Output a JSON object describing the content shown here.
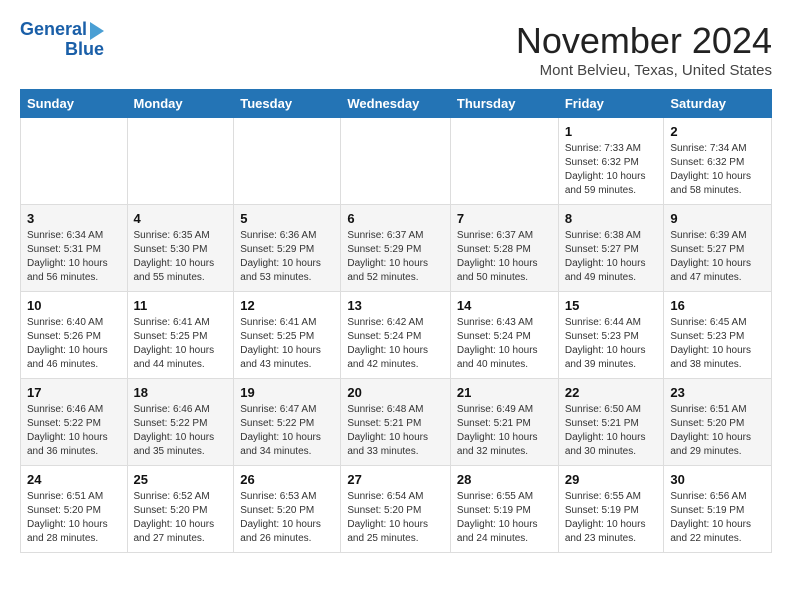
{
  "logo": {
    "line1": "General",
    "line2": "Blue"
  },
  "title": "November 2024",
  "subtitle": "Mont Belvieu, Texas, United States",
  "weekdays": [
    "Sunday",
    "Monday",
    "Tuesday",
    "Wednesday",
    "Thursday",
    "Friday",
    "Saturday"
  ],
  "weeks": [
    [
      {
        "day": "",
        "detail": ""
      },
      {
        "day": "",
        "detail": ""
      },
      {
        "day": "",
        "detail": ""
      },
      {
        "day": "",
        "detail": ""
      },
      {
        "day": "",
        "detail": ""
      },
      {
        "day": "1",
        "detail": "Sunrise: 7:33 AM\nSunset: 6:32 PM\nDaylight: 10 hours\nand 59 minutes."
      },
      {
        "day": "2",
        "detail": "Sunrise: 7:34 AM\nSunset: 6:32 PM\nDaylight: 10 hours\nand 58 minutes."
      }
    ],
    [
      {
        "day": "3",
        "detail": "Sunrise: 6:34 AM\nSunset: 5:31 PM\nDaylight: 10 hours\nand 56 minutes."
      },
      {
        "day": "4",
        "detail": "Sunrise: 6:35 AM\nSunset: 5:30 PM\nDaylight: 10 hours\nand 55 minutes."
      },
      {
        "day": "5",
        "detail": "Sunrise: 6:36 AM\nSunset: 5:29 PM\nDaylight: 10 hours\nand 53 minutes."
      },
      {
        "day": "6",
        "detail": "Sunrise: 6:37 AM\nSunset: 5:29 PM\nDaylight: 10 hours\nand 52 minutes."
      },
      {
        "day": "7",
        "detail": "Sunrise: 6:37 AM\nSunset: 5:28 PM\nDaylight: 10 hours\nand 50 minutes."
      },
      {
        "day": "8",
        "detail": "Sunrise: 6:38 AM\nSunset: 5:27 PM\nDaylight: 10 hours\nand 49 minutes."
      },
      {
        "day": "9",
        "detail": "Sunrise: 6:39 AM\nSunset: 5:27 PM\nDaylight: 10 hours\nand 47 minutes."
      }
    ],
    [
      {
        "day": "10",
        "detail": "Sunrise: 6:40 AM\nSunset: 5:26 PM\nDaylight: 10 hours\nand 46 minutes."
      },
      {
        "day": "11",
        "detail": "Sunrise: 6:41 AM\nSunset: 5:25 PM\nDaylight: 10 hours\nand 44 minutes."
      },
      {
        "day": "12",
        "detail": "Sunrise: 6:41 AM\nSunset: 5:25 PM\nDaylight: 10 hours\nand 43 minutes."
      },
      {
        "day": "13",
        "detail": "Sunrise: 6:42 AM\nSunset: 5:24 PM\nDaylight: 10 hours\nand 42 minutes."
      },
      {
        "day": "14",
        "detail": "Sunrise: 6:43 AM\nSunset: 5:24 PM\nDaylight: 10 hours\nand 40 minutes."
      },
      {
        "day": "15",
        "detail": "Sunrise: 6:44 AM\nSunset: 5:23 PM\nDaylight: 10 hours\nand 39 minutes."
      },
      {
        "day": "16",
        "detail": "Sunrise: 6:45 AM\nSunset: 5:23 PM\nDaylight: 10 hours\nand 38 minutes."
      }
    ],
    [
      {
        "day": "17",
        "detail": "Sunrise: 6:46 AM\nSunset: 5:22 PM\nDaylight: 10 hours\nand 36 minutes."
      },
      {
        "day": "18",
        "detail": "Sunrise: 6:46 AM\nSunset: 5:22 PM\nDaylight: 10 hours\nand 35 minutes."
      },
      {
        "day": "19",
        "detail": "Sunrise: 6:47 AM\nSunset: 5:22 PM\nDaylight: 10 hours\nand 34 minutes."
      },
      {
        "day": "20",
        "detail": "Sunrise: 6:48 AM\nSunset: 5:21 PM\nDaylight: 10 hours\nand 33 minutes."
      },
      {
        "day": "21",
        "detail": "Sunrise: 6:49 AM\nSunset: 5:21 PM\nDaylight: 10 hours\nand 32 minutes."
      },
      {
        "day": "22",
        "detail": "Sunrise: 6:50 AM\nSunset: 5:21 PM\nDaylight: 10 hours\nand 30 minutes."
      },
      {
        "day": "23",
        "detail": "Sunrise: 6:51 AM\nSunset: 5:20 PM\nDaylight: 10 hours\nand 29 minutes."
      }
    ],
    [
      {
        "day": "24",
        "detail": "Sunrise: 6:51 AM\nSunset: 5:20 PM\nDaylight: 10 hours\nand 28 minutes."
      },
      {
        "day": "25",
        "detail": "Sunrise: 6:52 AM\nSunset: 5:20 PM\nDaylight: 10 hours\nand 27 minutes."
      },
      {
        "day": "26",
        "detail": "Sunrise: 6:53 AM\nSunset: 5:20 PM\nDaylight: 10 hours\nand 26 minutes."
      },
      {
        "day": "27",
        "detail": "Sunrise: 6:54 AM\nSunset: 5:20 PM\nDaylight: 10 hours\nand 25 minutes."
      },
      {
        "day": "28",
        "detail": "Sunrise: 6:55 AM\nSunset: 5:19 PM\nDaylight: 10 hours\nand 24 minutes."
      },
      {
        "day": "29",
        "detail": "Sunrise: 6:55 AM\nSunset: 5:19 PM\nDaylight: 10 hours\nand 23 minutes."
      },
      {
        "day": "30",
        "detail": "Sunrise: 6:56 AM\nSunset: 5:19 PM\nDaylight: 10 hours\nand 22 minutes."
      }
    ]
  ]
}
